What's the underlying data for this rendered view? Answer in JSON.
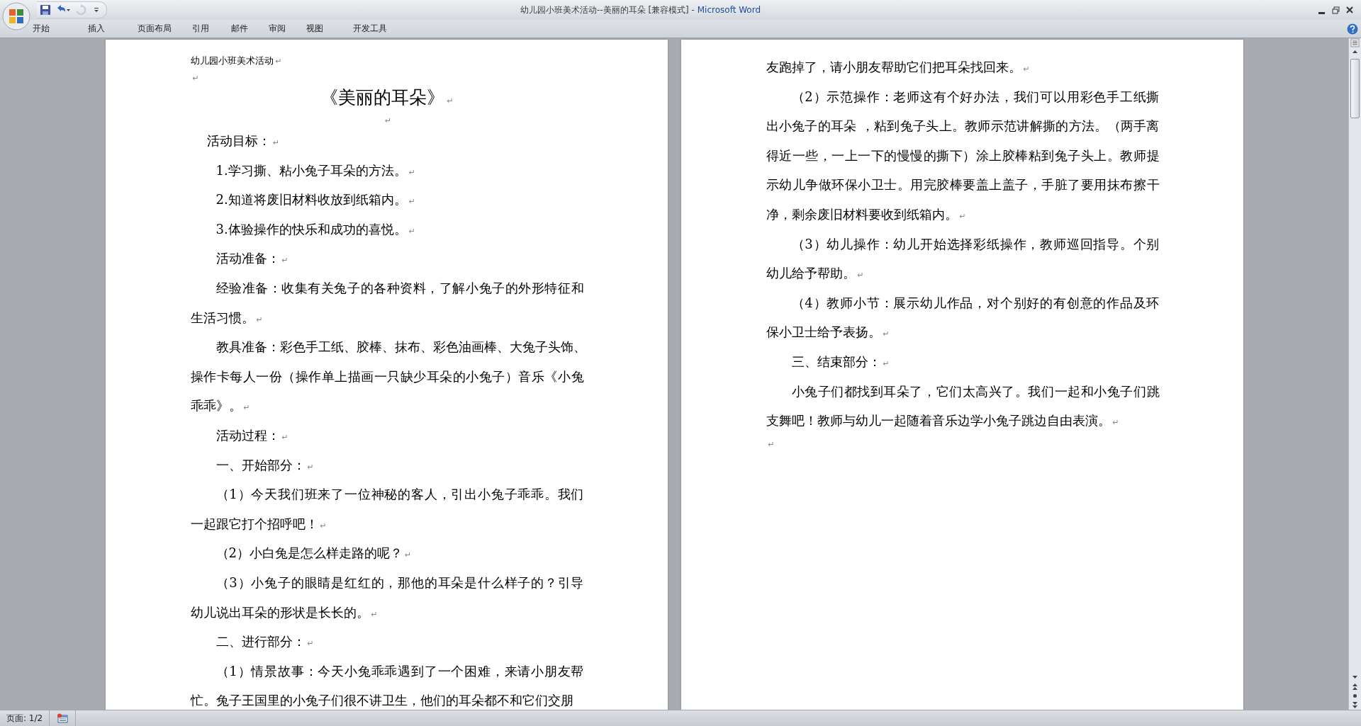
{
  "window": {
    "title": "幼儿园小班美术活动--美丽的耳朵 [兼容模式]",
    "separator": "-",
    "app_name": "Microsoft Word"
  },
  "quick_access": [
    {
      "kind": "save",
      "disabled": false
    },
    {
      "kind": "undo",
      "disabled": false
    },
    {
      "kind": "redo",
      "disabled": true
    }
  ],
  "tabs": [
    {
      "label": "开始"
    },
    {
      "label": "插入"
    },
    {
      "label": "页面布局"
    },
    {
      "label": "引用"
    },
    {
      "label": "邮件"
    },
    {
      "label": "审阅"
    },
    {
      "label": "视图"
    },
    {
      "label": "开发工具"
    }
  ],
  "pages": [
    {
      "paragraphs": [
        {
          "kind": "header",
          "lines": [
            "幼儿园小班美术活动"
          ],
          "mark": "↵"
        },
        {
          "kind": "empty",
          "mark": "↵"
        },
        {
          "kind": "title",
          "lines": [
            "《美丽的耳朵》"
          ],
          "mark": "↵"
        },
        {
          "kind": "centered_empty",
          "mark": "↵"
        },
        {
          "kind": "lead",
          "lines": [
            "活动目标："
          ],
          "mark": "↵"
        },
        {
          "kind": "body",
          "lines": [
            "1.学习撕、粘小兔子耳朵的方法。"
          ],
          "mark": "↵"
        },
        {
          "kind": "body",
          "lines": [
            "2.知道将废旧材料收放到纸箱内。"
          ],
          "mark": "↵"
        },
        {
          "kind": "body",
          "lines": [
            "3.体验操作的快乐和成功的喜悦。"
          ],
          "mark": "↵"
        },
        {
          "kind": "body",
          "lines": [
            "活动准备："
          ],
          "mark": "↵"
        },
        {
          "kind": "body",
          "lines": [
            "经验准备：收集有关兔子的各种资料，了解小兔子的外形特征和",
            "生活习惯。"
          ],
          "mark": "↵"
        },
        {
          "kind": "body",
          "lines": [
            "教具准备：彩色手工纸、胶棒、抹布、彩色油画棒、大兔子头饰、",
            "操作卡每人一份（操作单上描画一只缺少耳朵的小兔子）音乐《小兔",
            "乖乖》。"
          ],
          "mark": "↵"
        },
        {
          "kind": "body",
          "lines": [
            "活动过程："
          ],
          "mark": "↵"
        },
        {
          "kind": "body",
          "lines": [
            "一、开始部分："
          ],
          "mark": "↵"
        },
        {
          "kind": "body",
          "lines": [
            "（1）今天我们班来了一位神秘的客人，引出小兔子乖乖。我们",
            "一起跟它打个招呼吧！"
          ],
          "mark": "↵"
        },
        {
          "kind": "body",
          "lines": [
            "（2）小白兔是怎么样走路的呢？"
          ],
          "mark": "↵"
        },
        {
          "kind": "body",
          "lines": [
            "（3）小兔子的眼睛是红红的，那他的耳朵是什么样子的？引导",
            "幼儿说出耳朵的形状是长长的。"
          ],
          "mark": "↵"
        },
        {
          "kind": "body",
          "lines": [
            "二、进行部分："
          ],
          "mark": "↵"
        },
        {
          "kind": "body",
          "lines": [
            "（1）情景故事：今天小兔乖乖遇到了一个困难，来请小朋友帮",
            "忙。兔子王国里的小兔子们很不讲卫生，他们的耳朵都不和它们交朋"
          ]
        }
      ]
    },
    {
      "paragraphs": [
        {
          "kind": "continued",
          "lines": [
            "友跑掉了，请小朋友帮助它们把耳朵找回来。"
          ],
          "mark": "↵"
        },
        {
          "kind": "body",
          "lines": [
            "（2）示范操作：老师这有个好办法，我们可以用彩色手工纸撕",
            "出小兔子的耳朵 ，粘到兔子头上。教师示范讲解撕的方法。（两手离",
            "得近一些，一上一下的慢慢的撕下）涂上胶棒粘到兔子头上。教师提",
            "示幼儿争做环保小卫士。用完胶棒要盖上盖子，手脏了要用抹布擦干",
            "净，剩余废旧材料要收到纸箱内。"
          ],
          "mark": "↵"
        },
        {
          "kind": "body",
          "lines": [
            "（3）幼儿操作：幼儿开始选择彩纸操作，教师巡回指导。个别",
            "幼儿给予帮助。"
          ],
          "mark": "↵"
        },
        {
          "kind": "body",
          "lines": [
            "（4）教师小节：展示幼儿作品，对个别好的有创意的作品及环",
            "保小卫士给予表扬。"
          ],
          "mark": "↵"
        },
        {
          "kind": "body",
          "lines": [
            "三、结束部分："
          ],
          "mark": "↵"
        },
        {
          "kind": "body",
          "lines": [
            "小兔子们都找到耳朵了，它们太高兴了。我们一起和小兔子们跳",
            "支舞吧！教师与幼儿一起随着音乐边学小兔子跳边自由表演。"
          ],
          "mark": "↵"
        },
        {
          "kind": "empty",
          "mark": "↵"
        }
      ]
    }
  ],
  "status_bar": {
    "page": "页面: 1/2"
  }
}
